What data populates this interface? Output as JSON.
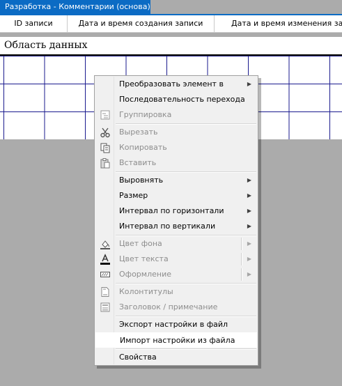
{
  "window": {
    "title": "Разработка - Комментарии (основа)"
  },
  "header": {
    "columns": [
      "ID записи",
      "Дата и время создания записи",
      "Дата и время изменения записи"
    ]
  },
  "section": {
    "title": "Область данных"
  },
  "context_menu": {
    "items": [
      {
        "label": "Преобразовать элемент в",
        "enabled": true,
        "submenu": true
      },
      {
        "label": "Последовательность перехода",
        "enabled": true,
        "submenu": false
      },
      {
        "label": "Группировка",
        "enabled": false,
        "submenu": false,
        "icon": "grouping-icon"
      },
      {
        "label": "Вырезать",
        "enabled": false,
        "submenu": false,
        "icon": "scissors-icon"
      },
      {
        "label": "Копировать",
        "enabled": false,
        "submenu": false,
        "icon": "copy-icon"
      },
      {
        "label": "Вставить",
        "enabled": false,
        "submenu": false,
        "icon": "paste-icon"
      },
      {
        "label": "Выровнять",
        "enabled": true,
        "submenu": true
      },
      {
        "label": "Размер",
        "enabled": true,
        "submenu": true
      },
      {
        "label": "Интервал по горизонтали",
        "enabled": true,
        "submenu": true
      },
      {
        "label": "Интервал по вертикали",
        "enabled": true,
        "submenu": true
      },
      {
        "label": "Цвет фона",
        "enabled": false,
        "submenu": true,
        "split": true,
        "icon": "fill-color-icon"
      },
      {
        "label": "Цвет текста",
        "enabled": false,
        "submenu": true,
        "split": true,
        "icon": "font-color-icon"
      },
      {
        "label": "Оформление",
        "enabled": false,
        "submenu": true,
        "split": true,
        "icon": "special-effect-icon"
      },
      {
        "label": "Колонтитулы",
        "enabled": false,
        "submenu": false,
        "icon": "header-footer-icon"
      },
      {
        "label": "Заголовок / примечание",
        "enabled": false,
        "submenu": false,
        "icon": "header-note-icon"
      },
      {
        "label": "Экспорт настройки в файл",
        "enabled": true,
        "submenu": false
      },
      {
        "label": "Импорт настройки из файла",
        "enabled": true,
        "submenu": false,
        "highlighted": true
      },
      {
        "label": "Свойства",
        "enabled": true,
        "submenu": false
      }
    ]
  },
  "colors": {
    "title_tab": "#0b6bc4",
    "grid_lines": "#1a1a8e",
    "workspace": "#ababab",
    "menu_background": "#f0f0f0",
    "disabled_text": "#8d8d8d"
  }
}
